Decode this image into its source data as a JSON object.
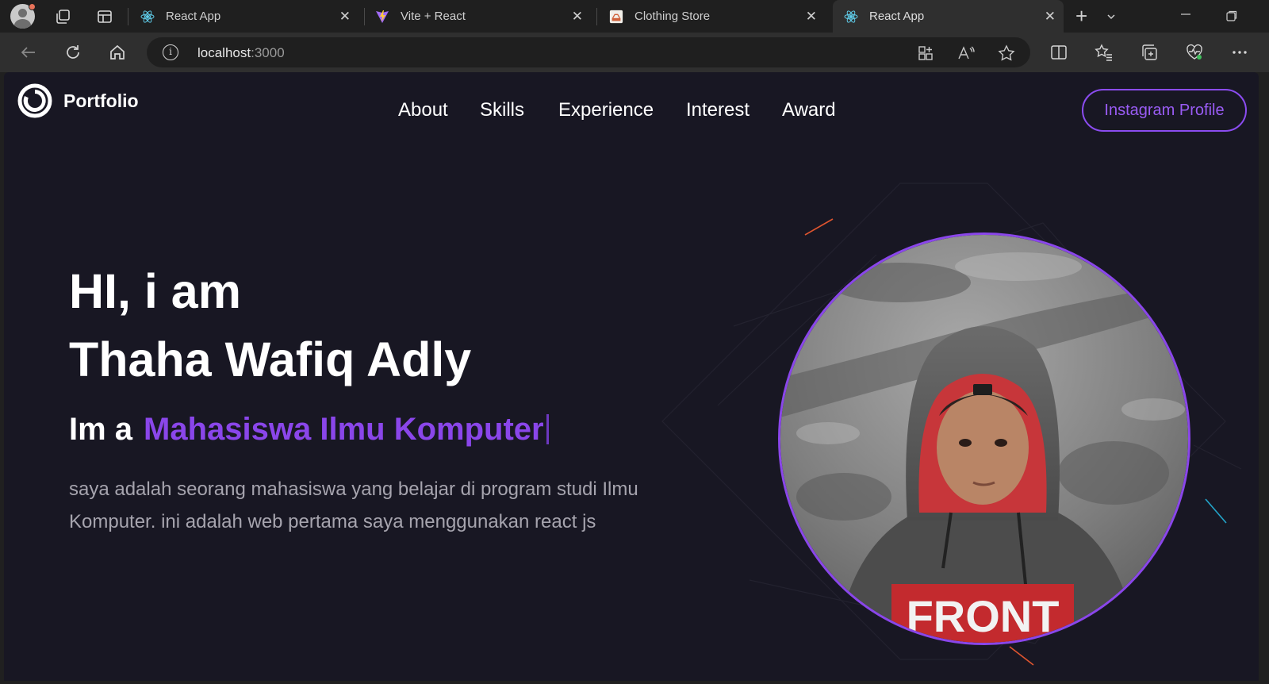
{
  "browser": {
    "tabs": [
      {
        "title": "React App",
        "favicon": "react-icon",
        "active": false
      },
      {
        "title": "Vite + React",
        "favicon": "vite-icon",
        "active": false
      },
      {
        "title": "Clothing Store",
        "favicon": "store-icon",
        "active": false
      },
      {
        "title": "React App",
        "favicon": "react-icon",
        "active": true
      }
    ],
    "url_host": "localhost",
    "url_port": ":3000"
  },
  "page": {
    "logo_text": "Portfolio",
    "nav": [
      "About",
      "Skills",
      "Experience",
      "Interest",
      "Award"
    ],
    "cta_label": "Instagram Profile",
    "greeting": "HI, i am",
    "name": "Thaha Wafiq Adly",
    "role_prefix": "Im a",
    "role_word": "Mahasiswa Ilmu Komputer",
    "description": "saya adalah seorang mahasiswa yang belajar di program studi Ilmu Komputer. ini adalah web pertama saya menggunakan react js",
    "photo_shirt_text": "FRONT"
  },
  "colors": {
    "page_bg": "#181723",
    "accent": "#8a46ea",
    "text": "#ffffff",
    "muted_text": "#a6a4ae"
  }
}
